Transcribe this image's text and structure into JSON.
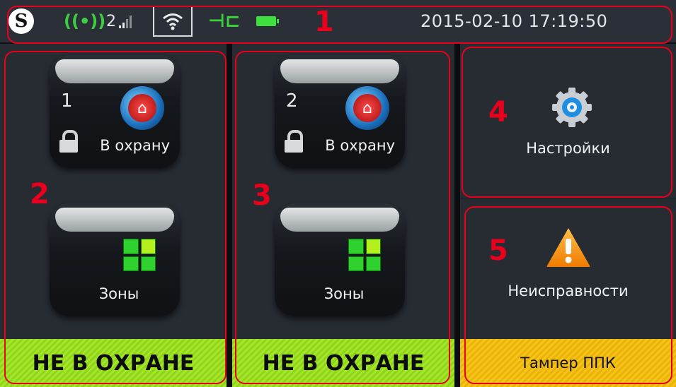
{
  "statusbar": {
    "logo_letter": "S",
    "signal_icon": "((•))",
    "gsm_level": "2",
    "plug_icon": "⊣⊏",
    "datetime": "2015-02-10 17:19:50"
  },
  "partition1": {
    "number": "1",
    "arm_label": "В охрану",
    "zones_label": "Зоны",
    "status": "НЕ В ОХРАНЕ"
  },
  "partition2": {
    "number": "2",
    "arm_label": "В охрану",
    "zones_label": "Зоны",
    "status": "НЕ В ОХРАНЕ"
  },
  "settings": {
    "label": "Настройки"
  },
  "faults": {
    "label": "Неисправности",
    "status": "Тампер ППК"
  },
  "annotations": [
    "1",
    "2",
    "3",
    "4",
    "5"
  ],
  "colors": {
    "status_green": "#a5e62a",
    "status_amber": "#f7c415",
    "annotation_red": "#e8001d"
  }
}
